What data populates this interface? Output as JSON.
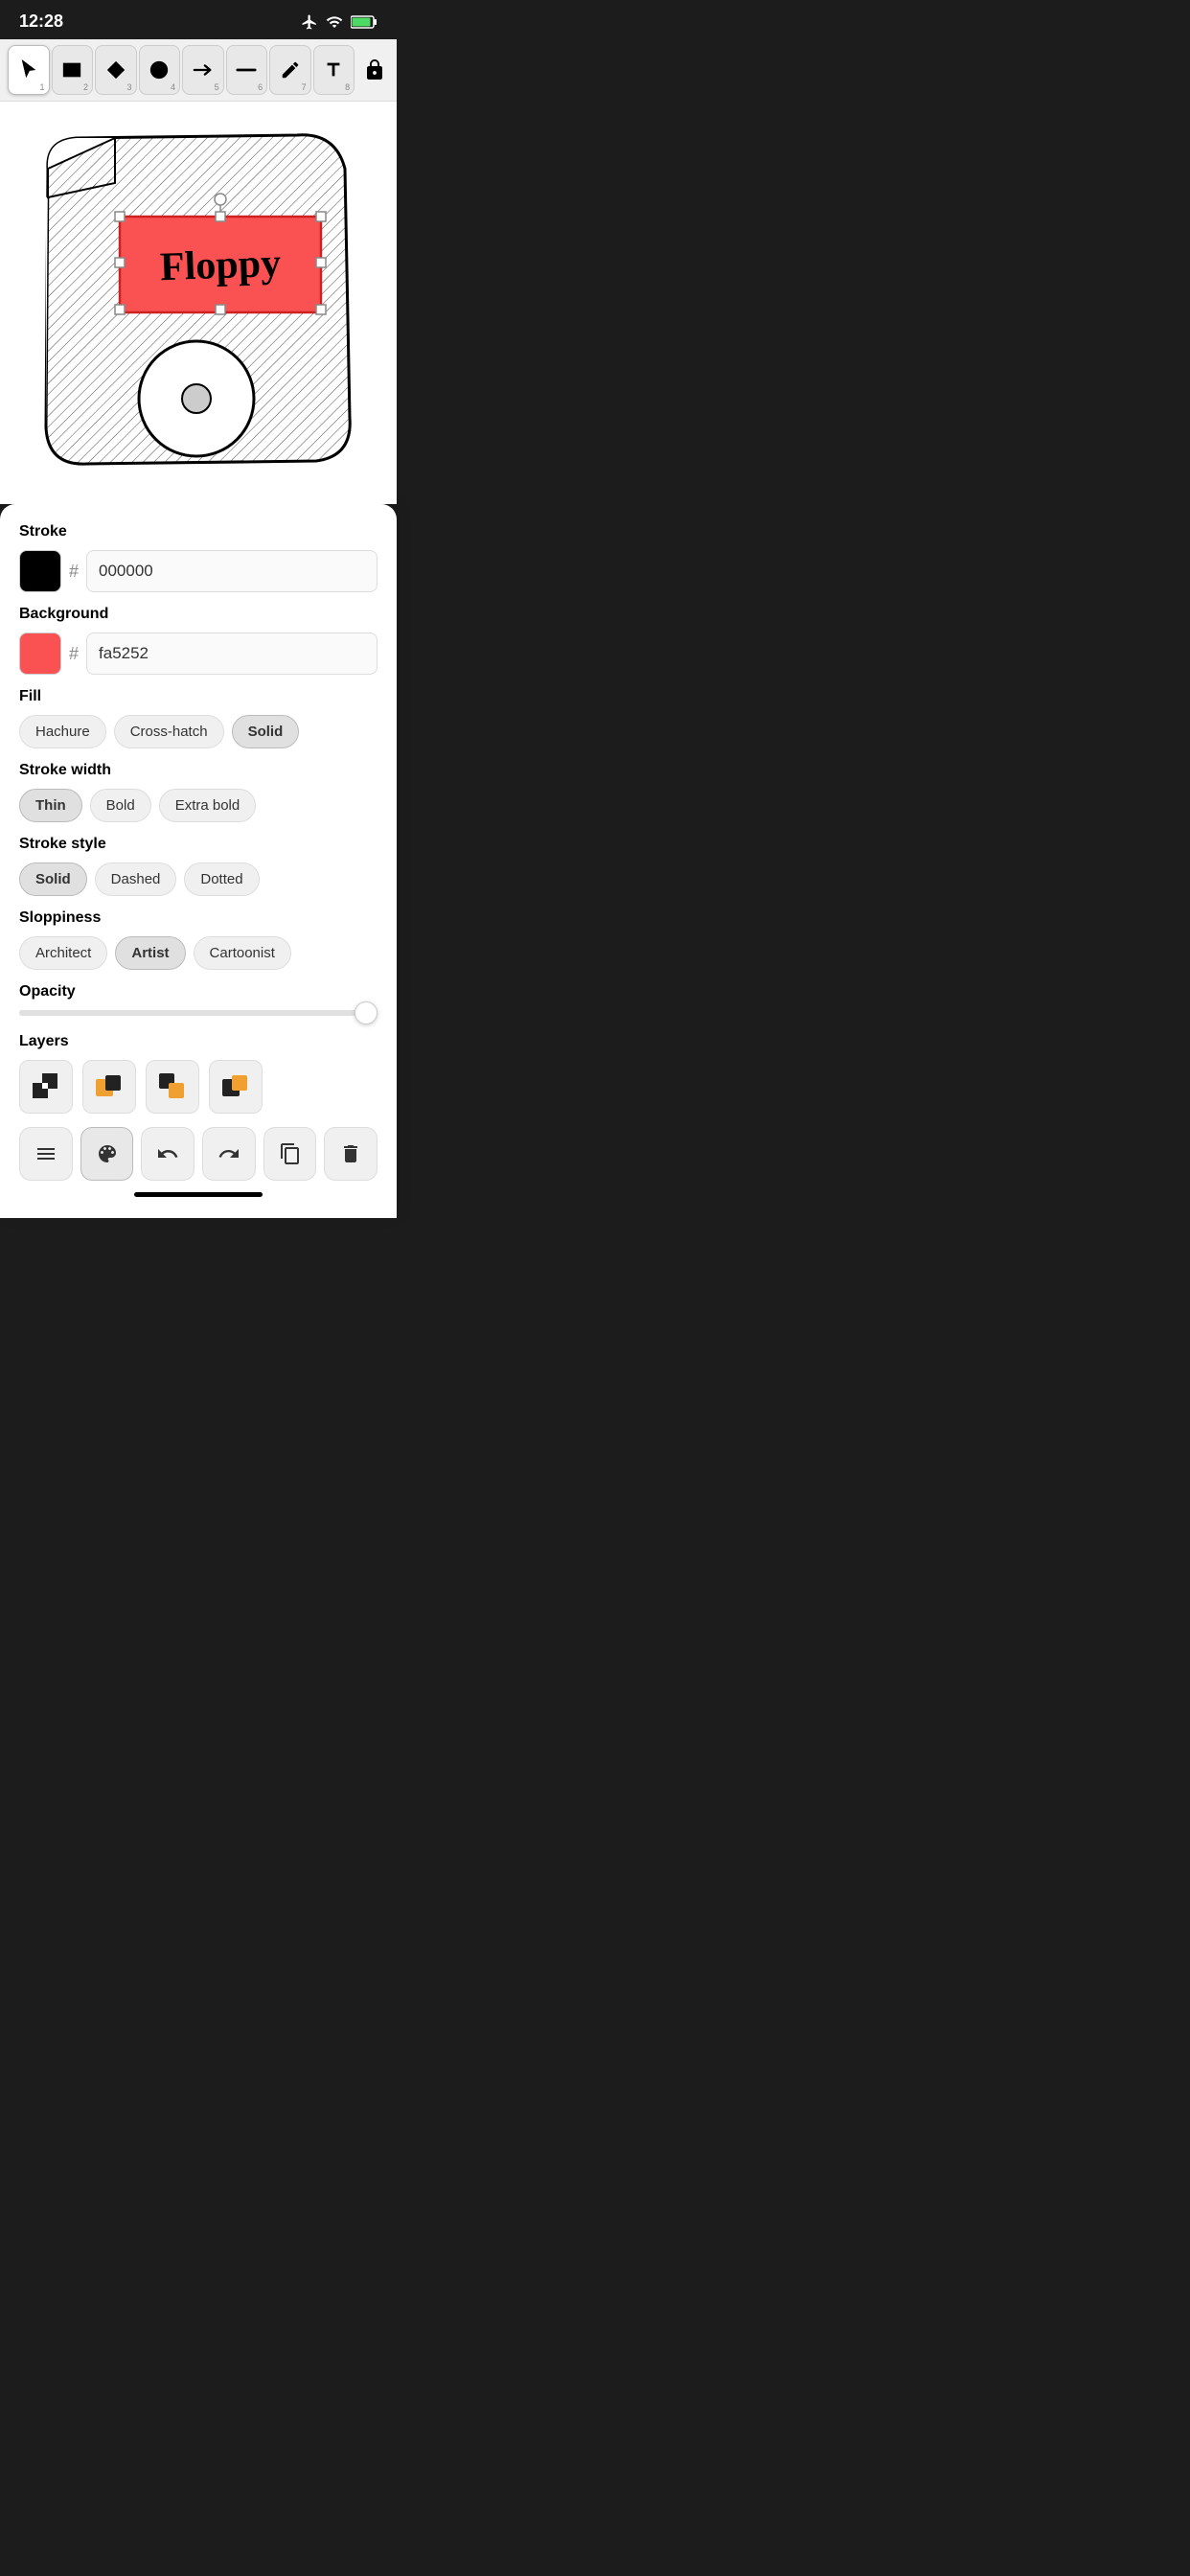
{
  "statusBar": {
    "time": "12:28",
    "timeIcon": "location-icon"
  },
  "toolbar": {
    "tools": [
      {
        "id": 1,
        "label": "cursor",
        "icon": "▶",
        "active": false
      },
      {
        "id": 2,
        "label": "rectangle",
        "icon": "■",
        "active": false
      },
      {
        "id": 3,
        "label": "diamond",
        "icon": "◆",
        "active": false
      },
      {
        "id": 4,
        "label": "circle",
        "icon": "●",
        "active": false
      },
      {
        "id": 5,
        "label": "arrow",
        "icon": "→",
        "active": false
      },
      {
        "id": 6,
        "label": "line",
        "icon": "—",
        "active": false
      },
      {
        "id": 7,
        "label": "pencil",
        "icon": "✏",
        "active": false
      },
      {
        "id": 8,
        "label": "text",
        "icon": "A",
        "active": false
      }
    ],
    "lockIcon": "🔓"
  },
  "panel": {
    "stroke": {
      "label": "Stroke",
      "color": "#000000",
      "hex": "000000"
    },
    "background": {
      "label": "Background",
      "color": "#fa5252",
      "hex": "fa5252"
    },
    "fill": {
      "label": "Fill",
      "options": [
        "Hachure",
        "Cross-hatch",
        "Solid"
      ],
      "selected": "Solid"
    },
    "strokeWidth": {
      "label": "Stroke width",
      "options": [
        "Thin",
        "Bold",
        "Extra bold"
      ],
      "selected": "Thin"
    },
    "strokeStyle": {
      "label": "Stroke style",
      "options": [
        "Solid",
        "Dashed",
        "Dotted"
      ],
      "selected": "Solid"
    },
    "sloppiness": {
      "label": "Sloppiness",
      "options": [
        "Architect",
        "Artist",
        "Cartoonist"
      ],
      "selected": "Artist"
    },
    "opacity": {
      "label": "Opacity",
      "value": 100
    },
    "layers": {
      "label": "Layers"
    }
  },
  "actionBar": {
    "menu": "☰",
    "palette": "🎨",
    "undo": "↩",
    "redo": "↪",
    "copy": "⧉",
    "delete": "🗑"
  }
}
